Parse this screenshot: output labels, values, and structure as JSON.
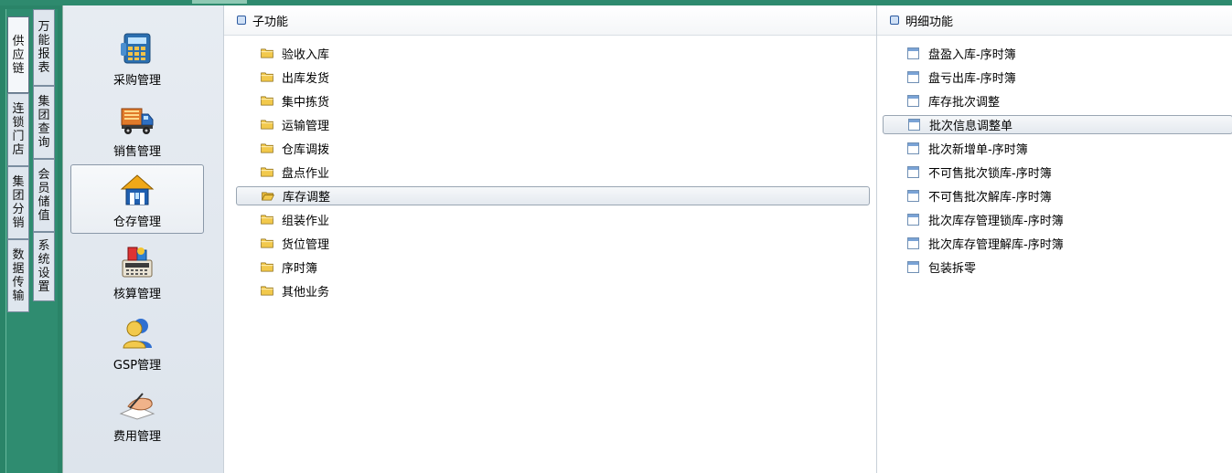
{
  "side_tabs": [
    {
      "label": "供应链"
    },
    {
      "label": "连锁门店"
    },
    {
      "label": "集团分销"
    },
    {
      "label": "数据传输"
    },
    {
      "label": "万能报表"
    },
    {
      "label": "集团查询"
    },
    {
      "label": "会员储值"
    },
    {
      "label": "系统设置"
    }
  ],
  "modules": [
    {
      "label": "采购管理",
      "icon": "calculator-icon"
    },
    {
      "label": "销售管理",
      "icon": "truck-icon"
    },
    {
      "label": "仓存管理",
      "icon": "warehouse-icon"
    },
    {
      "label": "核算管理",
      "icon": "accounting-icon"
    },
    {
      "label": "GSP管理",
      "icon": "users-icon"
    },
    {
      "label": "费用管理",
      "icon": "writing-hand-icon"
    }
  ],
  "active_module": "仓存管理",
  "mid_panel": {
    "title": "子功能",
    "items": [
      "验收入库",
      "出库发货",
      "集中拣货",
      "运输管理",
      "仓库调拨",
      "盘点作业",
      "库存调整",
      "组装作业",
      "货位管理",
      "序时簿",
      "其他业务"
    ],
    "selected": "库存调整"
  },
  "right_panel": {
    "title": "明细功能",
    "items": [
      "盘盈入库-序时簿",
      "盘亏出库-序时簿",
      "库存批次调整",
      "批次信息调整单",
      "批次新增单-序时簿",
      "不可售批次锁库-序时簿",
      "不可售批次解库-序时簿",
      "批次库存管理锁库-序时簿",
      "批次库存管理解库-序时簿",
      "包装拆零"
    ],
    "selected": "批次信息调整单"
  },
  "colors": {
    "frame_green": "#2e8a6e",
    "selection_border": "#9aa6b3",
    "folder_yellow": "#f2c94c"
  }
}
